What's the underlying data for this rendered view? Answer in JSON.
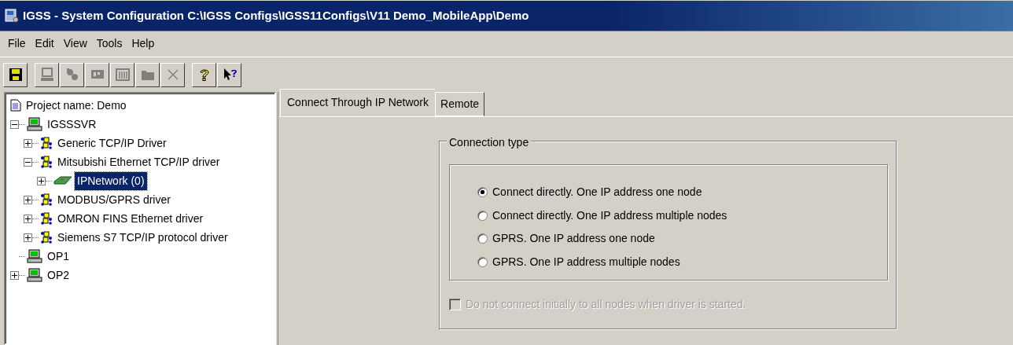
{
  "window": {
    "title": "IGSS -  System Configuration C:\\IGSS Configs\\IGSS11Configs\\V11 Demo_MobileApp\\Demo"
  },
  "menu": [
    "File",
    "Edit",
    "View",
    "Tools",
    "Help"
  ],
  "toolbar": [
    {
      "kind": "save",
      "disabled": false
    },
    {
      "kind": "computer",
      "disabled": true
    },
    {
      "kind": "driver",
      "disabled": true
    },
    {
      "kind": "network",
      "disabled": true
    },
    {
      "kind": "station",
      "disabled": true
    },
    {
      "kind": "folder",
      "disabled": true
    },
    {
      "kind": "delete",
      "disabled": true
    },
    {
      "kind": "help",
      "disabled": false
    },
    {
      "kind": "whatsthis",
      "disabled": false
    }
  ],
  "tree": [
    {
      "kind": "project",
      "label": "Project name: Demo",
      "selected": false
    },
    {
      "kind": "computer",
      "label": "IGSSSVR",
      "expanded": true,
      "selected": false,
      "children": [
        {
          "kind": "driver",
          "label": "Generic TCP/IP Driver",
          "expanded": false,
          "selected": false
        },
        {
          "kind": "driver",
          "label": "Mitsubishi Ethernet TCP/IP driver",
          "expanded": true,
          "selected": false,
          "children": [
            {
              "kind": "network",
              "label": "IPNetwork (0)",
              "expanded": false,
              "selected": true
            }
          ]
        },
        {
          "kind": "driver",
          "label": "MODBUS/GPRS driver",
          "expanded": false,
          "selected": false
        },
        {
          "kind": "driver",
          "label": "OMRON FINS Ethernet driver",
          "expanded": false,
          "selected": false
        },
        {
          "kind": "driver",
          "label": "Siemens S7 TCP/IP protocol driver",
          "expanded": false,
          "selected": false
        }
      ]
    },
    {
      "kind": "computer",
      "label": "OP1",
      "selected": false
    },
    {
      "kind": "computer",
      "label": "OP2",
      "expanded": false,
      "selected": false
    }
  ],
  "tabs": [
    {
      "label": "Connect Through IP Network",
      "selected": true
    },
    {
      "label": "Remote",
      "selected": false
    }
  ],
  "connection_type": {
    "title": "Connection type",
    "options": [
      {
        "label": "Connect directly. One IP address one node",
        "selected": true
      },
      {
        "label": "Connect directly. One IP address multiple nodes",
        "selected": false
      },
      {
        "label": "GPRS. One IP address one node",
        "selected": false
      },
      {
        "label": "GPRS. One IP address multiple nodes",
        "selected": false
      }
    ]
  },
  "initial_connect": {
    "label": "Do not connect initially to all nodes when driver is started.",
    "checked": false,
    "disabled": true
  }
}
